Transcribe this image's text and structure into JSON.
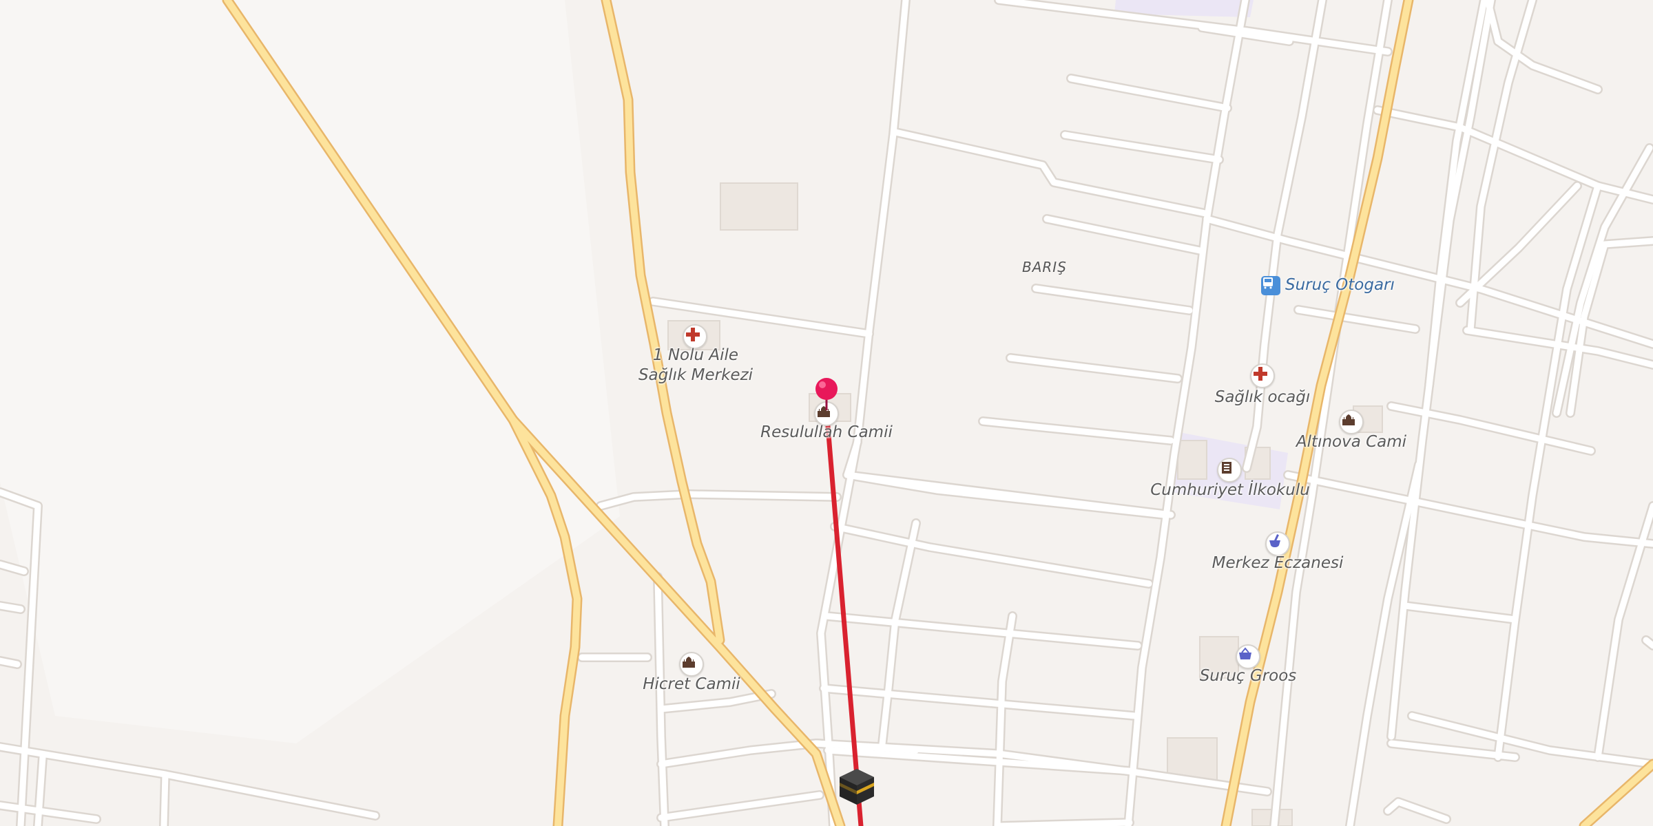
{
  "map": {
    "area_label": "BARIŞ",
    "pois": [
      {
        "id": "health-center-1",
        "label_lines": [
          "1 Nolu Aile",
          "Sağlık Merkezi"
        ],
        "icon": "medical-cross-icon"
      },
      {
        "id": "resulullah-mosque",
        "label": "Resulullah Camii",
        "icon": "mosque-icon",
        "selected": true
      },
      {
        "id": "hicret-mosque",
        "label": "Hicret Camii",
        "icon": "mosque-icon"
      },
      {
        "id": "bus-station",
        "label": "Suruç Otogarı",
        "icon": "bus-icon"
      },
      {
        "id": "health-clinic",
        "label": "Sağlık ocağı",
        "icon": "medical-cross-icon"
      },
      {
        "id": "altinova-mosque",
        "label": "Altınova Cami",
        "icon": "mosque-icon"
      },
      {
        "id": "school",
        "label": "Cumhuriyet İlkokulu",
        "icon": "school-icon"
      },
      {
        "id": "pharmacy",
        "label": "Merkez Eczanesi",
        "icon": "pharmacy-mortar-icon"
      },
      {
        "id": "grocery",
        "label": "Suruç Groos",
        "icon": "shopping-basket-icon"
      }
    ],
    "markers": {
      "pin": "location-pin-icon",
      "qibla": "kaaba-icon"
    },
    "colors": {
      "background": "#f5f2ef",
      "road": "#ffffff",
      "road_casing": "#dcd6d0",
      "major_road": "#fde39c",
      "major_road_casing": "#e8b66a",
      "qibla_line": "#d9222f",
      "pin": "#e8185a",
      "school_area": "#ebe6f5",
      "medical": "#c0392b",
      "pharmacy": "#5a62c8",
      "bus": "#4a8fd9"
    }
  }
}
